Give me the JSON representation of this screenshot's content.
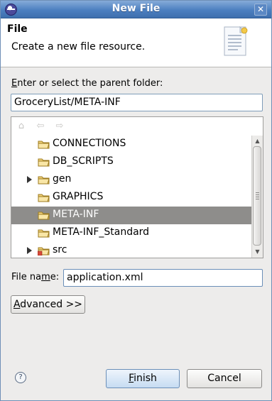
{
  "window": {
    "title": "New File",
    "close_glyph": "✕",
    "icon": "eclipse-icon"
  },
  "header": {
    "title": "File",
    "description": "Create a new file resource."
  },
  "parent_folder": {
    "label_prefix": "",
    "label_mnemonic": "E",
    "label_rest": "nter or select the parent folder:",
    "value": "GroceryList/META-INF"
  },
  "tree": {
    "toolbar": {
      "home": "⌂",
      "back": "⇦",
      "forward": "⇨"
    },
    "items": [
      {
        "label": "CONNECTIONS",
        "expandable": false,
        "selected": false
      },
      {
        "label": "DB_SCRIPTS",
        "expandable": false,
        "selected": false
      },
      {
        "label": "gen",
        "expandable": true,
        "selected": false
      },
      {
        "label": "GRAPHICS",
        "expandable": false,
        "selected": false
      },
      {
        "label": "META-INF",
        "expandable": false,
        "selected": true
      },
      {
        "label": "META-INF_Standard",
        "expandable": false,
        "selected": false
      },
      {
        "label": "src",
        "expandable": true,
        "selected": false
      }
    ]
  },
  "file_name": {
    "label_prefix": "File na",
    "label_mnemonic": "m",
    "label_rest": "e:",
    "value": "application.xml"
  },
  "buttons": {
    "advanced_mnemonic": "A",
    "advanced_rest": "dvanced >>",
    "finish_mnemonic": "F",
    "finish_rest": "inish",
    "cancel": "Cancel",
    "help": "?"
  },
  "colors": {
    "title_bar": "#4c7fc0",
    "selection": "#8e8d8b",
    "dialog_bg": "#edeceb"
  }
}
